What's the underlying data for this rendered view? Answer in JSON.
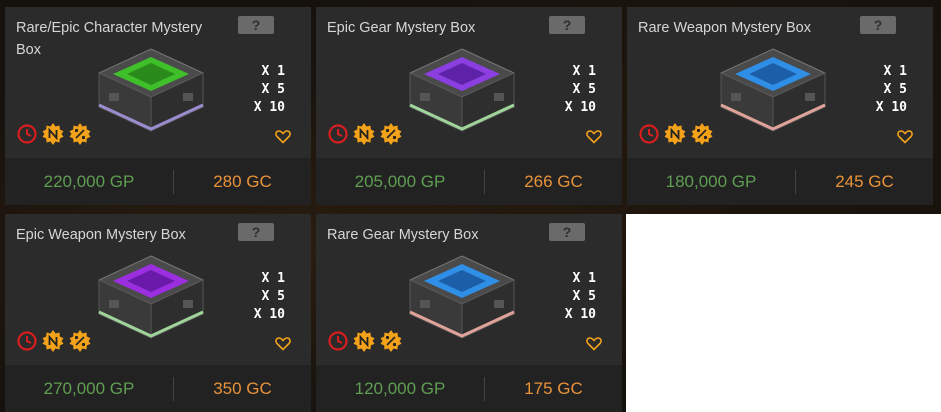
{
  "unknown_badge": "?",
  "cards": [
    {
      "title": "Rare/Epic Character Mystery Box",
      "quantities": [
        "X 1",
        "X 5",
        "X 10"
      ],
      "price_gp": "220,000 GP",
      "price_gc": "280 GC",
      "glow": "#9b8ccf",
      "core": "#3fbf2a"
    },
    {
      "title": "Epic Gear Mystery Box",
      "quantities": [
        "X 1",
        "X 5",
        "X 10"
      ],
      "price_gp": "205,000 GP",
      "price_gc": "266 GC",
      "glow": "#9fd49a",
      "core": "#8b3fe0"
    },
    {
      "title": "Rare Weapon Mystery Box",
      "quantities": [
        "X 1",
        "X 5",
        "X 10"
      ],
      "price_gp": "180,000 GP",
      "price_gc": "245 GC",
      "glow": "#e0a39a",
      "core": "#2f8fe6"
    },
    {
      "title": "Epic Weapon Mystery Box",
      "quantities": [
        "X 1",
        "X 5",
        "X 10"
      ],
      "price_gp": "270,000 GP",
      "price_gc": "350 GC",
      "glow": "#9fd49a",
      "core": "#9b2fe0"
    },
    {
      "title": "Rare Gear Mystery Box",
      "quantities": [
        "X 1",
        "X 5",
        "X 10"
      ],
      "price_gp": "120,000 GP",
      "price_gc": "175 GC",
      "glow": "#e0a39a",
      "core": "#2f8fe6"
    }
  ],
  "colors": {
    "gp": "#5f9e52",
    "gc": "#e8923a",
    "clock": "#d81e1e",
    "badge": "#f3a21a",
    "heart": "#f3a21a"
  },
  "icons": [
    "clock-icon",
    "new-badge-icon",
    "discount-badge-icon",
    "heart-icon",
    "mystery-box-icon"
  ]
}
